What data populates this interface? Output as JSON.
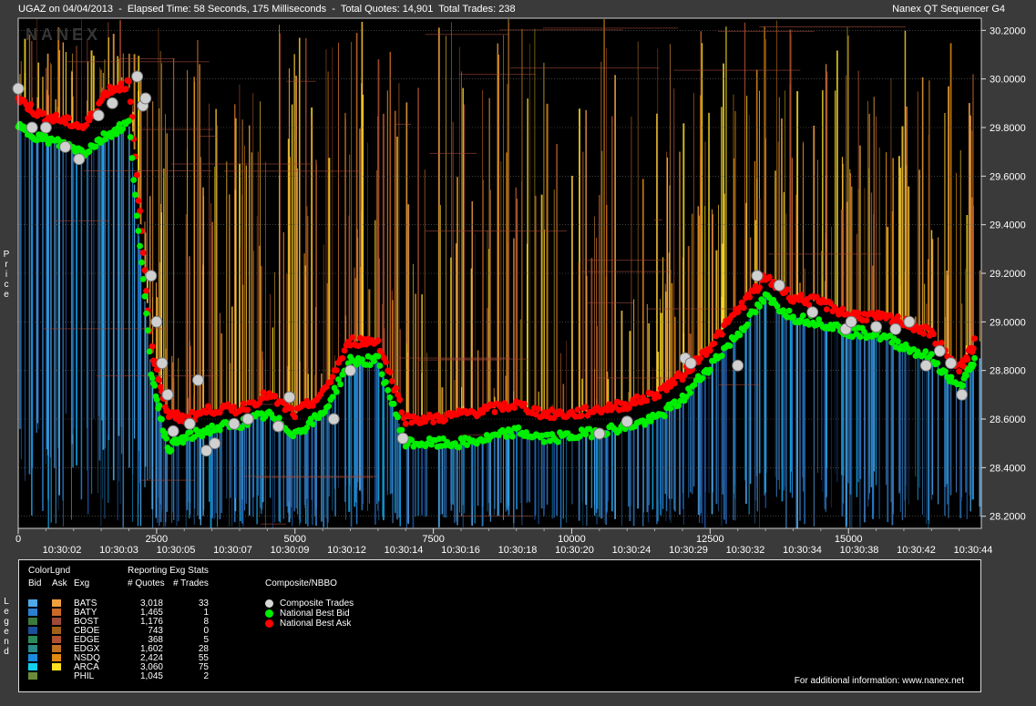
{
  "header": {
    "left": "UGAZ on 04/04/2013  -  Elapsed Time: 58 Seconds, 175 Milliseconds  -  Total Quotes: 14,901  Total Trades: 238",
    "right": "Nanex QT Sequencer G4"
  },
  "watermark": "NANEX",
  "side_label_price": "Price",
  "side_label_legend": "Legend",
  "chart_data": {
    "type": "scatter",
    "ylabel": "Price",
    "ylim": [
      28.15,
      30.25
    ],
    "xlim": [
      0,
      17400
    ],
    "y_ticks": [
      "30.2000",
      "30.0000",
      "29.8000",
      "29.6000",
      "29.4000",
      "29.2000",
      "29.0000",
      "28.8000",
      "28.6000",
      "28.4000",
      "28.2000"
    ],
    "x_ticks_sequence": [
      "0",
      "2500",
      "5000",
      "7500",
      "10000",
      "12500",
      "15000"
    ],
    "x_ticks_time": [
      "10:30:02",
      "10:30:03",
      "10:30:05",
      "10:30:07",
      "10:30:09",
      "10:30:12",
      "10:30:14",
      "10:30:16",
      "10:30:18",
      "10:30:20",
      "10:30:24",
      "10:30:29",
      "10:30:32",
      "10:30:34",
      "10:30:38",
      "10:30:42",
      "10:30:44"
    ],
    "series": [
      {
        "name": "National Best Bid",
        "color": "#00ee00",
        "x": [
          0,
          400,
          800,
          1200,
          1600,
          2000,
          2400,
          2700,
          3000,
          3500,
          4000,
          4500,
          5000,
          5500,
          6000,
          6500,
          7000,
          7500,
          8000,
          8500,
          9000,
          9500,
          10000,
          10500,
          11000,
          11500,
          12000,
          12500,
          13000,
          13500,
          14000,
          14500,
          15000,
          15500,
          16000,
          16500,
          17000,
          17300
        ],
        "y": [
          29.8,
          29.76,
          29.73,
          29.7,
          29.77,
          29.82,
          28.8,
          28.48,
          28.52,
          28.56,
          28.58,
          28.62,
          28.54,
          28.62,
          28.84,
          28.84,
          28.5,
          28.5,
          28.5,
          28.52,
          28.55,
          28.52,
          28.53,
          28.55,
          28.57,
          28.6,
          28.68,
          28.82,
          28.95,
          29.1,
          29.02,
          29.0,
          28.96,
          28.95,
          28.9,
          28.85,
          28.72,
          28.85
        ]
      },
      {
        "name": "National Best Ask",
        "color": "#ff0000",
        "x": [
          0,
          400,
          800,
          1200,
          1600,
          2000,
          2400,
          2700,
          3000,
          3500,
          4000,
          4500,
          5000,
          5500,
          6000,
          6500,
          7000,
          7500,
          8000,
          8500,
          9000,
          9500,
          10000,
          10500,
          11000,
          11500,
          12000,
          12500,
          13000,
          13500,
          14000,
          14500,
          15000,
          15500,
          16000,
          16500,
          17000,
          17300
        ],
        "y": [
          29.92,
          29.85,
          29.83,
          29.8,
          29.95,
          29.98,
          28.9,
          28.62,
          28.6,
          28.64,
          28.64,
          28.7,
          28.62,
          28.7,
          28.92,
          28.92,
          28.6,
          28.6,
          28.62,
          28.64,
          28.66,
          28.62,
          28.62,
          28.64,
          28.66,
          28.7,
          28.78,
          28.9,
          29.05,
          29.18,
          29.1,
          29.08,
          29.03,
          29.02,
          29.0,
          28.95,
          28.8,
          28.92
        ]
      },
      {
        "name": "Composite Trades",
        "color": "#d0d0d0",
        "x": [
          0,
          250,
          500,
          850,
          1100,
          1450,
          1700,
          2150,
          2250,
          2300,
          2400,
          2500,
          2600,
          2700,
          2800,
          3100,
          3250,
          3400,
          3550,
          3900,
          4150,
          4700,
          4900,
          5700,
          6000,
          6950,
          10500,
          11000,
          12050,
          12150,
          13000,
          13350,
          13750,
          14350,
          14950,
          15050,
          15500,
          15850,
          16100,
          16400,
          16650,
          16850,
          17050
        ],
        "y": [
          29.96,
          29.8,
          29.8,
          29.72,
          29.67,
          29.85,
          29.9,
          30.01,
          29.89,
          29.92,
          29.19,
          29.0,
          28.83,
          28.7,
          28.55,
          28.58,
          28.76,
          28.47,
          28.5,
          28.58,
          28.6,
          28.57,
          28.69,
          28.6,
          28.8,
          28.52,
          28.54,
          28.59,
          28.85,
          28.83,
          28.82,
          29.19,
          29.15,
          29.04,
          28.97,
          29.0,
          28.98,
          28.97,
          29.0,
          28.82,
          28.88,
          28.83,
          28.7
        ]
      }
    ]
  },
  "legend": {
    "header_colorlgnd": "ColorLgnd",
    "header_bid": "Bid",
    "header_ask": "Ask",
    "header_exg": "Exg",
    "header_reporting": "Reporting Exg Stats",
    "header_quotes": "# Quotes",
    "header_trades": "# Trades",
    "header_composite": "Composite/NBBO",
    "rows": [
      {
        "exg": "BATS",
        "quotes": "3,018",
        "trades": "33",
        "bid": "#4fa8e8",
        "ask": "#f0a040"
      },
      {
        "exg": "BATY",
        "quotes": "1,465",
        "trades": "1",
        "bid": "#2a7fd0",
        "ask": "#c86a28"
      },
      {
        "exg": "BOST",
        "quotes": "1,176",
        "trades": "8",
        "bid": "#3c7a3c",
        "ask": "#a04a3a"
      },
      {
        "exg": "CBOE",
        "quotes": "743",
        "trades": "0",
        "bid": "#1a4f9a",
        "ask": "#a06018"
      },
      {
        "exg": "EDGE",
        "quotes": "368",
        "trades": "5",
        "bid": "#2c8a5a",
        "ask": "#b05030"
      },
      {
        "exg": "EDGX",
        "quotes": "1,602",
        "trades": "28",
        "bid": "#2a8a8a",
        "ask": "#c07020"
      },
      {
        "exg": "NSDQ",
        "quotes": "2,424",
        "trades": "55",
        "bid": "#1a8ae0",
        "ask": "#e08a10"
      },
      {
        "exg": "ARCA",
        "quotes": "3,060",
        "trades": "75",
        "bid": "#10d0f0",
        "ask": "#ffe020"
      },
      {
        "exg": "PHIL",
        "quotes": "1,045",
        "trades": "2",
        "bid": "#6a8a3a",
        "ask": ""
      }
    ],
    "composite": [
      {
        "label": "Composite Trades",
        "color": "#d8d8d8"
      },
      {
        "label": "National Best Bid",
        "color": "#00ee00"
      },
      {
        "label": "National Best Ask",
        "color": "#ff0000"
      }
    ],
    "footer": "For additional information: www.nanex.net"
  }
}
